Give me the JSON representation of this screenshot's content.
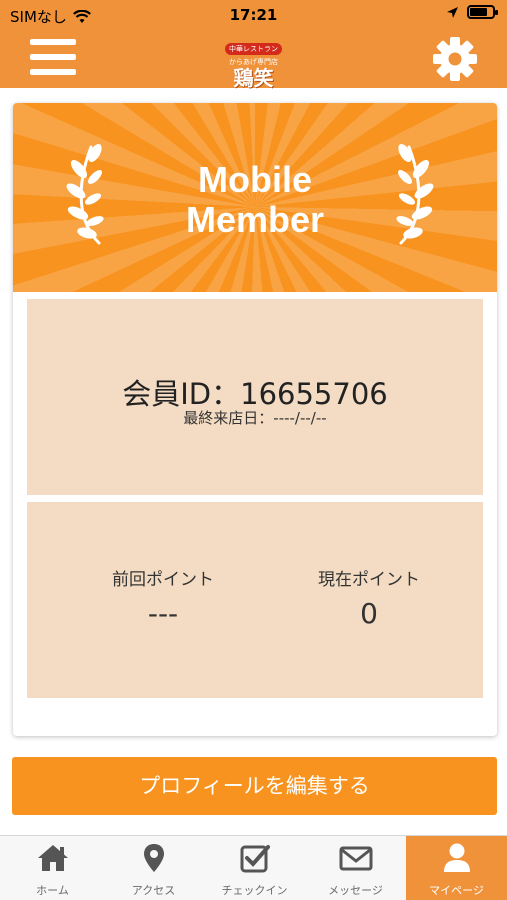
{
  "status_bar": {
    "carrier": "SIMなし",
    "time": "17:21"
  },
  "header": {
    "logo": {
      "badge": "中華レストラン",
      "sub": "からあげ専門店",
      "name": "鶏笑"
    }
  },
  "banner": {
    "title_line1": "Mobile",
    "title_line2": "Member"
  },
  "member": {
    "id_text": "会員ID：16655706",
    "last_visit_text": "最終来店日：----/--/--"
  },
  "points": {
    "previous_label": "前回ポイント",
    "previous_value": "---",
    "current_label": "現在ポイント",
    "current_value": "0"
  },
  "edit_profile_label": "プロフィールを編集する",
  "tabs": [
    {
      "label": "ホーム",
      "icon": "home-icon"
    },
    {
      "label": "アクセス",
      "icon": "map-pin-icon"
    },
    {
      "label": "チェックイン",
      "icon": "checkbox-icon"
    },
    {
      "label": "メッセージ",
      "icon": "envelope-icon"
    },
    {
      "label": "マイページ",
      "icon": "person-icon"
    }
  ],
  "colors": {
    "accent": "#f0923a",
    "banner": "#f7931e",
    "panel": "#f3dcc3"
  }
}
